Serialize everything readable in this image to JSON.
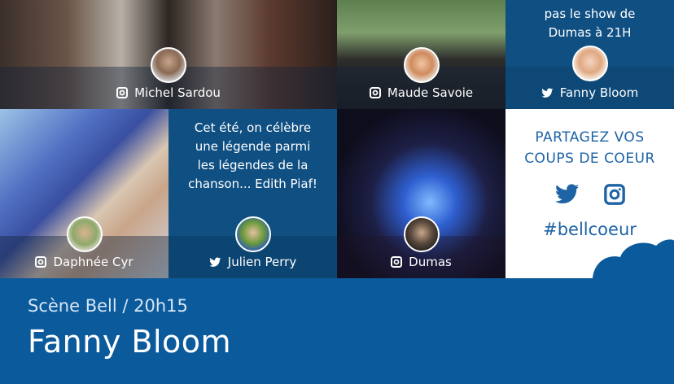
{
  "tiles": {
    "michel_sardou": {
      "name": "Michel Sardou",
      "network": "instagram"
    },
    "maude_savoie": {
      "name": "Maude Savoie",
      "network": "instagram"
    },
    "fanny_bloom_top": {
      "name": "Fanny Bloom",
      "network": "twitter",
      "text": "pas le show de Dumas à 21H"
    },
    "daphnee_cyr": {
      "name": "Daphnée Cyr",
      "network": "instagram"
    },
    "julien_perry": {
      "name": "Julien Perry",
      "network": "twitter",
      "text": "Cet été, on célèbre une légende parmi les légendes de la chanson... Edith Piaf!"
    },
    "dumas": {
      "name": "Dumas",
      "network": "instagram"
    }
  },
  "share": {
    "title_line1": "PARTAGEZ VOS",
    "title_line2": "COUPS DE COEUR",
    "hashtag": "#bellcoeur",
    "icons": [
      "twitter-icon",
      "instagram-icon"
    ]
  },
  "banner": {
    "subtitle": "Scène Bell / 20h15",
    "title": "Fanny Bloom"
  },
  "colors": {
    "brand_blue": "#0b5a9c",
    "card_blue": "#0f4f82",
    "share_text": "#1d63a6"
  }
}
